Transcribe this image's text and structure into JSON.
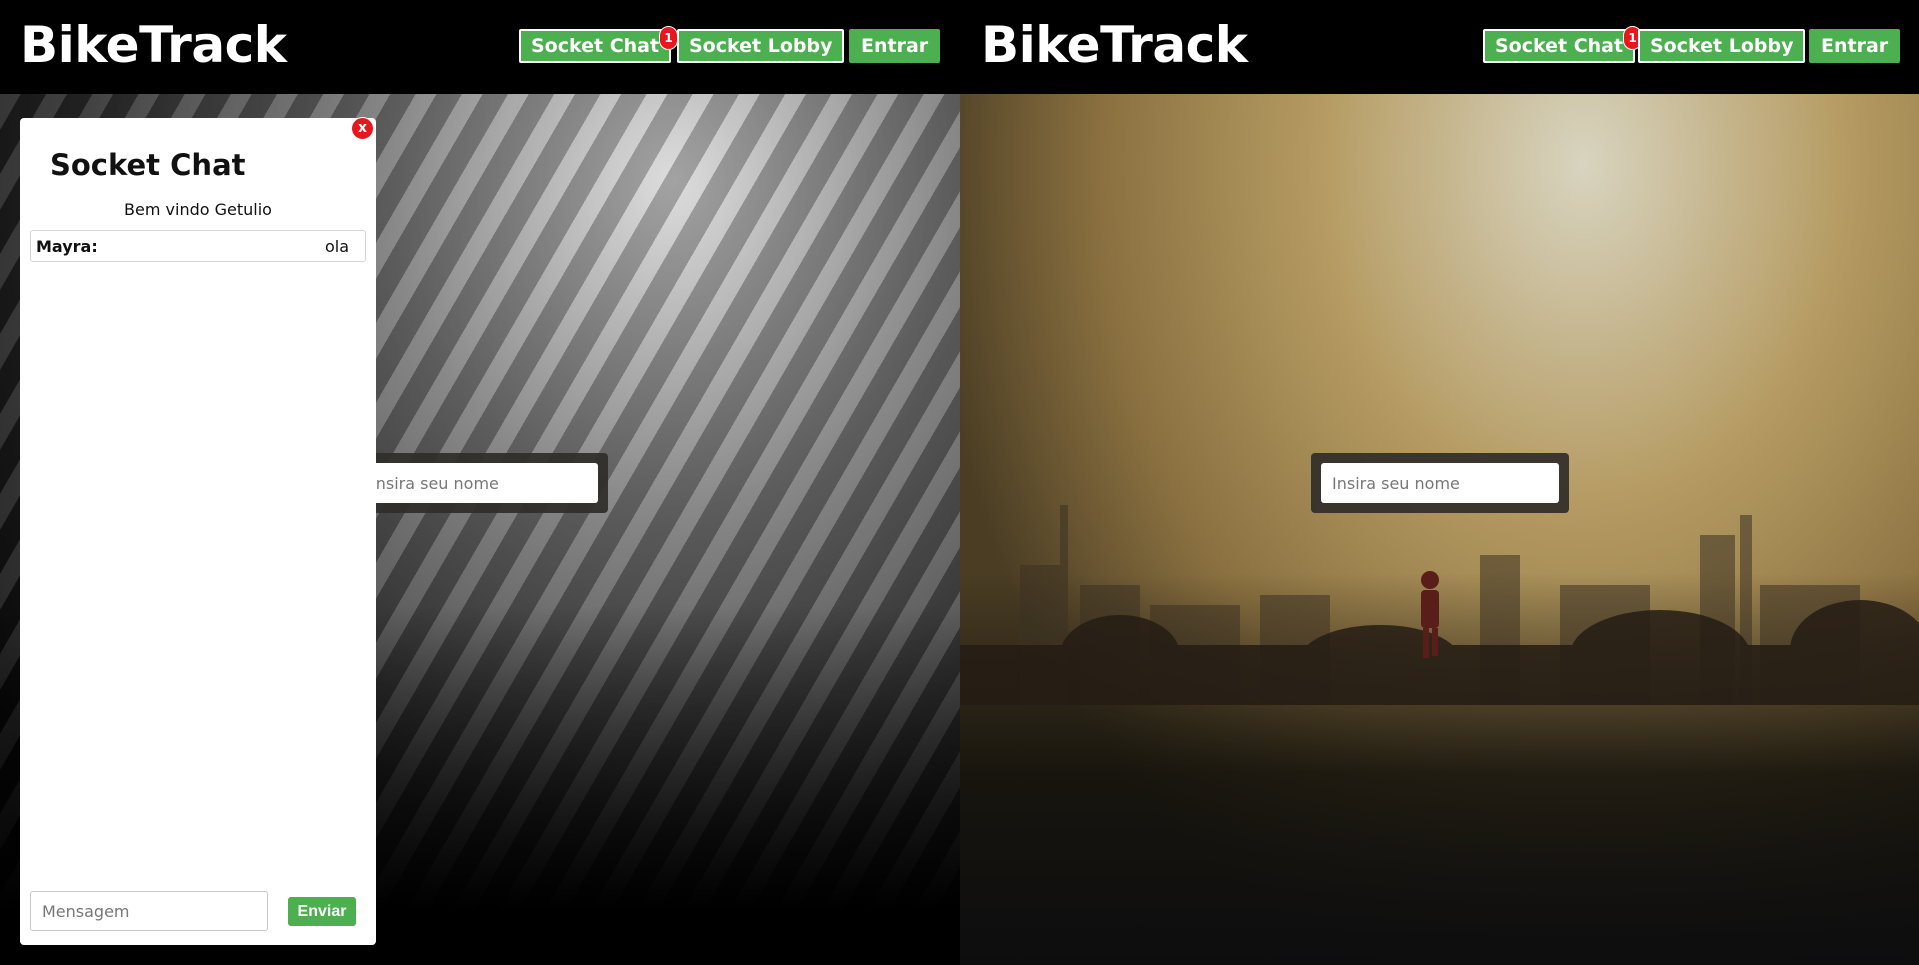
{
  "left_window": {
    "brand": "BikeTrack",
    "nav": {
      "socket_chat": "Socket Chat",
      "socket_chat_badge": "1",
      "socket_lobby": "Socket Lobby",
      "entrar": "Entrar"
    },
    "name_input_placeholder": "Insira seu nome",
    "chat": {
      "close": "x",
      "title": "Socket Chat",
      "welcome": "Bem vindo Getulio",
      "messages": [
        {
          "user": "Mayra:",
          "text": "ola"
        }
      ],
      "input_placeholder": "Mensagem",
      "send": "Enviar"
    }
  },
  "right_window": {
    "brand": "BikeTrack",
    "nav": {
      "socket_chat": "Socket Chat",
      "socket_chat_badge": "1",
      "socket_lobby": "Socket Lobby",
      "entrar": "Entrar"
    },
    "name_input_placeholder": "Insira seu nome"
  },
  "colors": {
    "accent_green": "#4caf50",
    "badge_red": "#e8171d",
    "navbar": "#000000"
  }
}
